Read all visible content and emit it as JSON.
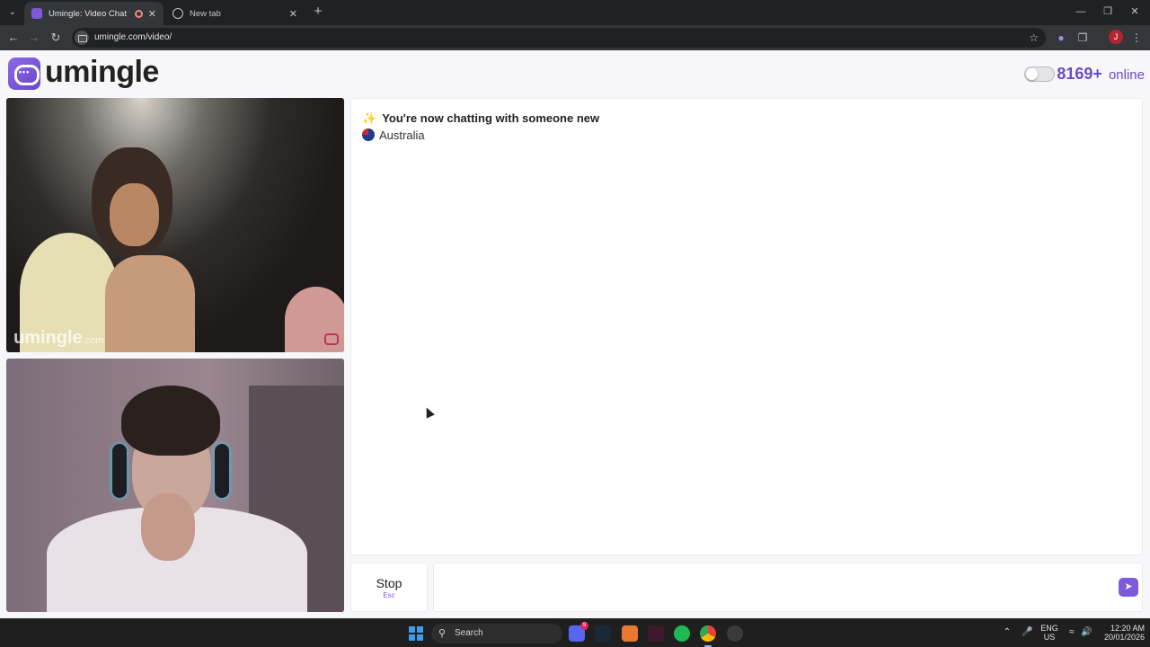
{
  "browser": {
    "tabs": [
      {
        "title": "Umingle: Video Chat with S",
        "active": true
      },
      {
        "title": "New tab",
        "active": false
      }
    ],
    "url": "umingle.com/video/",
    "profile_initial": "J"
  },
  "site": {
    "logo_text": "umingle",
    "online_count": "8169+",
    "online_label": "online",
    "video_watermark": "umingle",
    "video_watermark_tld": ".com"
  },
  "chat": {
    "system_message": "You're now chatting with someone new",
    "country": "Australia",
    "stop_label": "Stop",
    "stop_hint": "Esc",
    "message_placeholder": ""
  },
  "taskbar": {
    "search_label": "Search",
    "discord_badge": "9",
    "lang_top": "ENG",
    "lang_bottom": "US",
    "time": "12:20 AM",
    "date": "20/01/2026"
  },
  "colors": {
    "brand_purple": "#7c5ad9",
    "page_background": "#f7f7f9",
    "browser_dark": "#202124"
  },
  "icons": {
    "logo": "chat-bubble-icon",
    "sparkle": "sparkles-icon",
    "flag": "australia-flag-icon",
    "send": "send-arrow-icon"
  }
}
